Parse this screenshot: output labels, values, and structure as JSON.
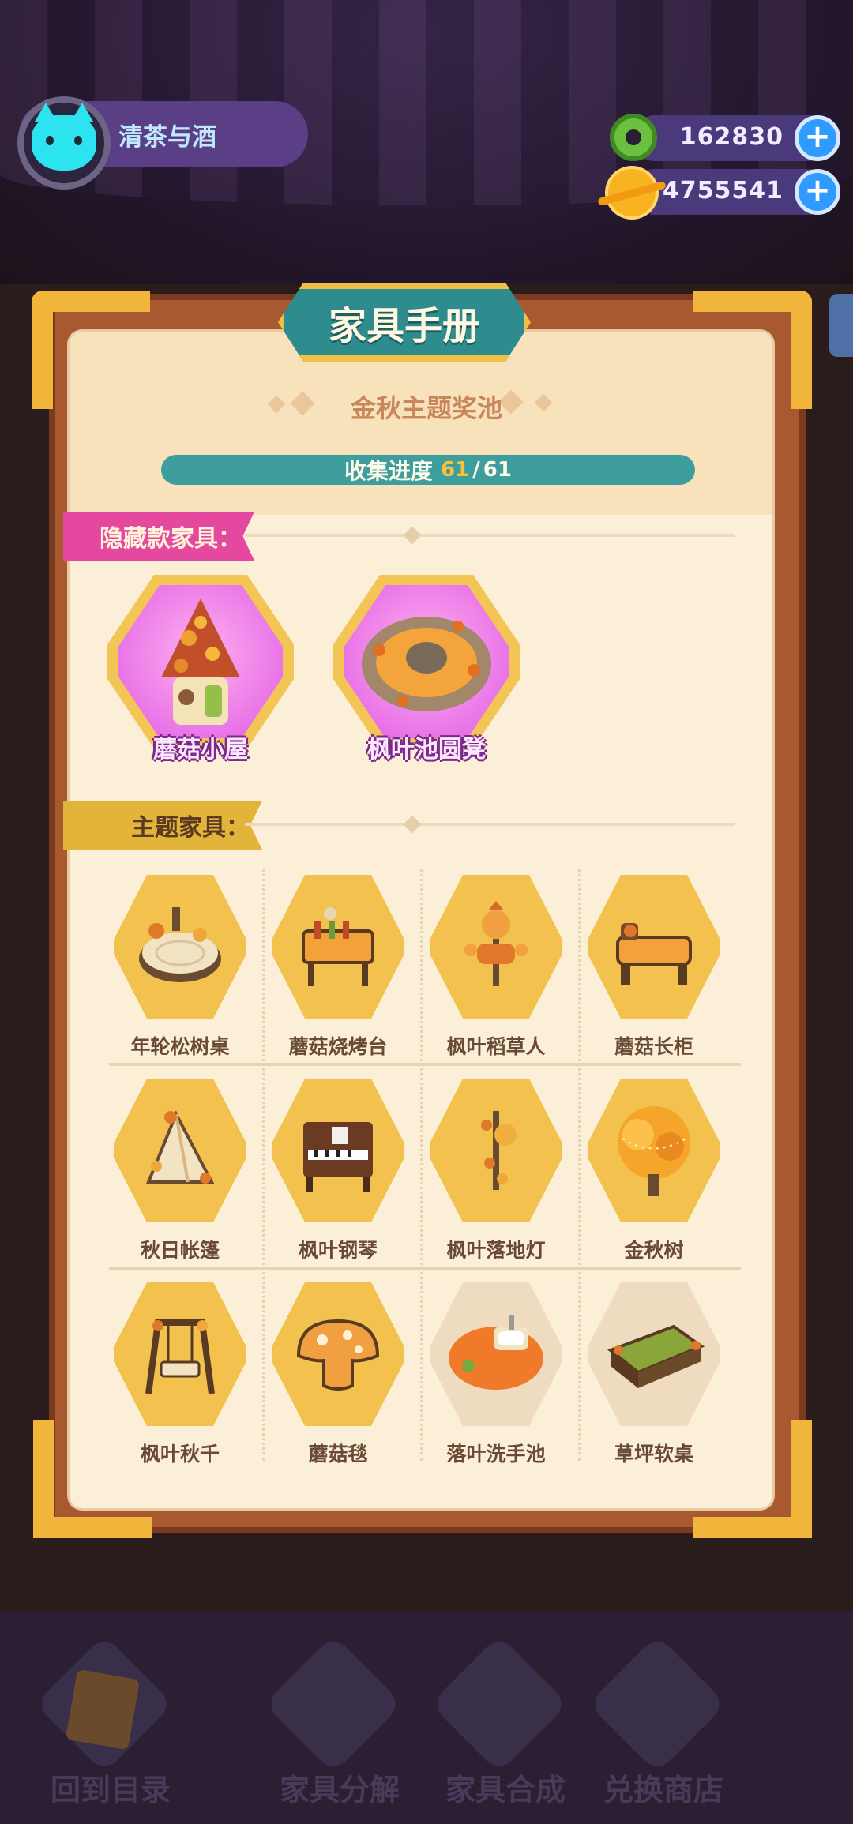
{
  "user": {
    "name": "清茶与酒"
  },
  "currencies": [
    {
      "name": "green-donut-currency",
      "value": "162830",
      "color": "#6bc13f"
    },
    {
      "name": "gold-planet-currency",
      "value": "4755541",
      "color": "#f7b420"
    }
  ],
  "board": {
    "title": "家具手册",
    "pool_title": "金秋主题奖池",
    "progress": {
      "label": "收集进度",
      "current": "61",
      "sep": "/",
      "total": "61",
      "fraction": 1.0
    }
  },
  "sections": {
    "hidden": {
      "label": "隐藏款家具：",
      "items": [
        {
          "label": "蘑菇小屋",
          "icon": "mushroom-house-icon"
        },
        {
          "label": "枫叶池圆凳",
          "icon": "maple-pond-stool-icon"
        }
      ]
    },
    "theme": {
      "label": "主题家具：",
      "items": [
        {
          "label": "年轮松树桌",
          "icon": "tree-ring-table-icon",
          "owned": true
        },
        {
          "label": "蘑菇烧烤台",
          "icon": "mushroom-grill-icon",
          "owned": true
        },
        {
          "label": "枫叶稻草人",
          "icon": "maple-scarecrow-icon",
          "owned": true
        },
        {
          "label": "蘑菇长柜",
          "icon": "mushroom-cabinet-icon",
          "owned": true
        },
        {
          "label": "秋日帐篷",
          "icon": "autumn-tent-icon",
          "owned": true
        },
        {
          "label": "枫叶钢琴",
          "icon": "maple-piano-icon",
          "owned": true
        },
        {
          "label": "枫叶落地灯",
          "icon": "maple-floor-lamp-icon",
          "owned": true
        },
        {
          "label": "金秋树",
          "icon": "golden-autumn-tree-icon",
          "owned": true
        },
        {
          "label": "枫叶秋千",
          "icon": "maple-swing-icon",
          "owned": true
        },
        {
          "label": "蘑菇毯",
          "icon": "mushroom-rug-icon",
          "owned": true
        },
        {
          "label": "落叶洗手池",
          "icon": "leaf-sink-icon",
          "owned": false
        },
        {
          "label": "草坪软桌",
          "icon": "lawn-soft-table-icon",
          "owned": false
        }
      ]
    }
  },
  "nav": [
    {
      "label": "回到目录",
      "icon": "back-to-catalog-icon"
    },
    {
      "label": "家具分解",
      "icon": "decompose-icon"
    },
    {
      "label": "家具合成",
      "icon": "craft-hammer-icon"
    },
    {
      "label": "兑换商店",
      "icon": "gift-shop-icon"
    }
  ]
}
